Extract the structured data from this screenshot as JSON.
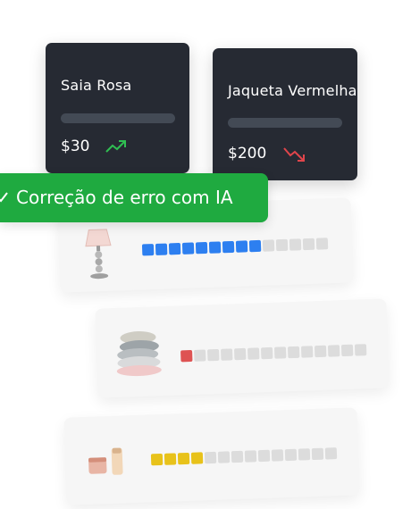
{
  "cards": [
    {
      "name": "Saia Rosa",
      "price": "$30",
      "trend": "up",
      "trend_color": "#2fbf52"
    },
    {
      "name": "Jaqueta Vermelha",
      "price": "$200",
      "trend": "down",
      "trend_color": "#e0454b"
    }
  ],
  "banner": {
    "label": "Correção de erro com IA",
    "icon": "check-icon",
    "color": "#1faa40"
  },
  "products": [
    {
      "icon": "lamp-icon",
      "level": 9,
      "total": 14,
      "fill_color": "#2d7ff0"
    },
    {
      "icon": "pillows-icon",
      "level": 1,
      "total": 14,
      "fill_color": "#de5353"
    },
    {
      "icon": "cosmetics-icon",
      "level": 4,
      "total": 14,
      "fill_color": "#e8c21a"
    }
  ]
}
